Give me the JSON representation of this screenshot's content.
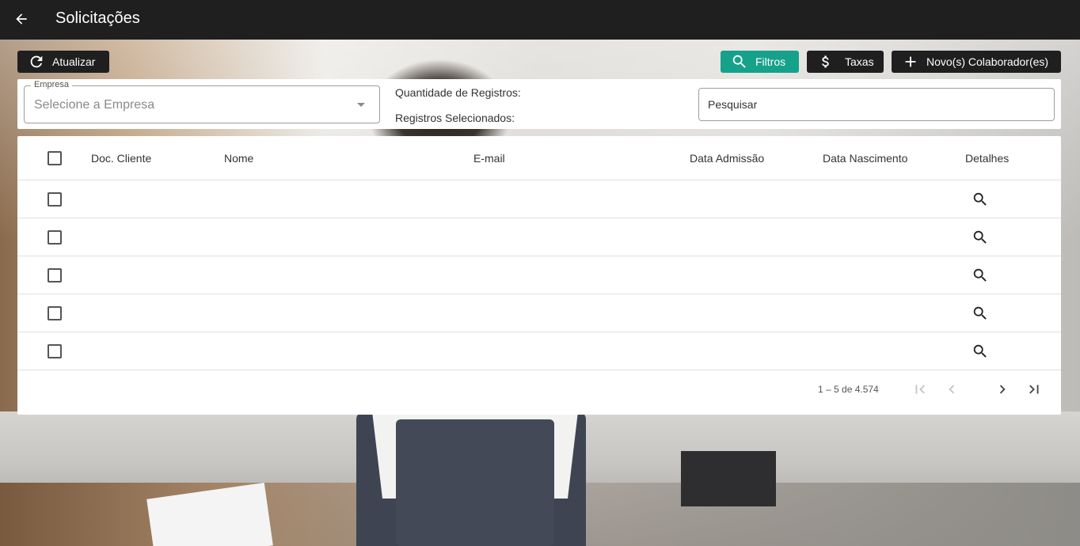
{
  "header": {
    "title": "Solicitações"
  },
  "toolbar": {
    "refresh_label": "Atualizar",
    "filter_label": "Filtros",
    "fees_label": "Taxas",
    "new_label": "Novo(s) Colaborador(es)"
  },
  "filters": {
    "empresa_label": "Empresa",
    "empresa_placeholder": "Selecione a Empresa",
    "quantity_label": "Quantidade de Registros:",
    "selected_label": "Registros Selecionados:",
    "search_placeholder": "Pesquisar"
  },
  "table": {
    "columns": [
      "Doc. Cliente",
      "Nome",
      "E-mail",
      "Data Admissão",
      "Data Nascimento",
      "Detalhes"
    ],
    "rows": [
      {
        "doc": "",
        "nome": "",
        "email": "",
        "admissao": "",
        "nascimento": ""
      },
      {
        "doc": "",
        "nome": "",
        "email": "",
        "admissao": "",
        "nascimento": ""
      },
      {
        "doc": "",
        "nome": "",
        "email": "",
        "admissao": "",
        "nascimento": ""
      },
      {
        "doc": "",
        "nome": "",
        "email": "",
        "admissao": "",
        "nascimento": ""
      },
      {
        "doc": "",
        "nome": "",
        "email": "",
        "admissao": "",
        "nascimento": ""
      }
    ]
  },
  "paginator": {
    "range": "1 – 5 de 4.574"
  },
  "colors": {
    "topbar": "#1f1f1f",
    "filter_button": "#16a18a",
    "dark_button": "#1f1f1f"
  },
  "icons": [
    "arrow-back-icon",
    "refresh-icon",
    "search-icon",
    "dollar-icon",
    "plus-icon",
    "first-page-icon",
    "chevron-left-icon",
    "chevron-right-icon",
    "last-page-icon"
  ]
}
